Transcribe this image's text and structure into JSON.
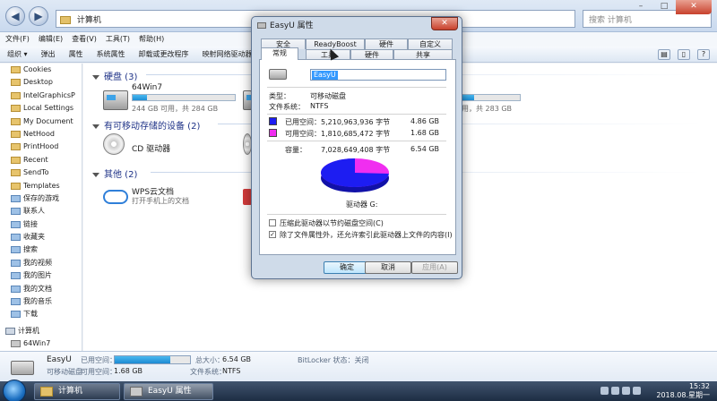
{
  "explorer": {
    "address": "计算机",
    "search_placeholder": "搜索 计算机",
    "window_buttons": {
      "min": "–",
      "max": "□",
      "close": "✕"
    },
    "menu": [
      "文件(F)",
      "编辑(E)",
      "查看(V)",
      "工具(T)",
      "帮助(H)"
    ],
    "toolbar": [
      "组织 ▾",
      "弹出",
      "属性",
      "系统属性",
      "卸载或更改程序",
      "映射网络驱动器"
    ]
  },
  "sidebar": {
    "items": [
      {
        "label": "Cookies"
      },
      {
        "label": "Desktop"
      },
      {
        "label": "IntelGraphicsP"
      },
      {
        "label": "Local Settings"
      },
      {
        "label": "My Document"
      },
      {
        "label": "NetHood"
      },
      {
        "label": "PrintHood"
      },
      {
        "label": "Recent"
      },
      {
        "label": "SendTo"
      },
      {
        "label": "Templates"
      },
      {
        "label": "保存的游戏"
      },
      {
        "label": "联系人"
      },
      {
        "label": "链接"
      },
      {
        "label": "收藏夹"
      },
      {
        "label": "搜索"
      },
      {
        "label": "我的视频"
      },
      {
        "label": "我的图片"
      },
      {
        "label": "我的文档"
      },
      {
        "label": "我的音乐"
      },
      {
        "label": "下载"
      }
    ],
    "computer": "计算机",
    "drive": "64Win7"
  },
  "content": {
    "hdd_group": "硬盘 (3)",
    "drive1_name": "64Win7",
    "drive1_sub": "244 GB 可用，共 284 GB",
    "drive1_fill": 0.14,
    "drive3_sub": "用，共 283 GB",
    "removable_group": "有可移动存储的设备 (2)",
    "cd_name": "CD 驱动器",
    "other_group": "其他 (2)",
    "wps_name": "WPS云文档",
    "wps_sub": "打开手机上的文档"
  },
  "details": {
    "name": "EasyU",
    "type": "可移动磁盘",
    "used_label": "已用空间：",
    "free_label": "可用空间：",
    "free_value": "1.68 GB",
    "total_label": "总大小：",
    "total_value": "6.54 GB",
    "fs_label": "文件系统：",
    "fs_value": "NTFS",
    "bitlocker": "BitLocker 状态：关闭",
    "used_fill": 0.74
  },
  "taskbar": {
    "task1": "计算机",
    "task2": "EasyU 属性",
    "time": "15:32",
    "date": "2018.08.星期一"
  },
  "dialog": {
    "title": "EasyU 属性",
    "close": "✕",
    "tabs_top": [
      "安全",
      "ReadyBoost",
      "硬件",
      "自定义"
    ],
    "tabs_bottom": [
      "常规",
      "工具",
      "硬件",
      "共享"
    ],
    "name_value": "EasyU",
    "type_label": "类型：",
    "type_value": "可移动磁盘",
    "fs_label": "文件系统：",
    "fs_value": "NTFS",
    "used_label": "已用空间：",
    "used_bytes": "5,210,963,936 字节",
    "used_gb": "4.86 GB",
    "free_label": "可用空间：",
    "free_bytes": "1,810,685,472 字节",
    "free_gb": "1.68 GB",
    "cap_label": "容量：",
    "cap_bytes": "7,028,649,408 字节",
    "cap_gb": "6.54 GB",
    "drive_label": "驱动器 G:",
    "compress_label": "压缩此驱动器以节约磁盘空间(C)",
    "index_label": "除了文件属性外，还允许索引此驱动器上文件的内容(I)",
    "ok": "确定",
    "cancel": "取消",
    "apply": "应用(A)",
    "used_color": "#1d1df2",
    "free_color": "#f02ef0",
    "used_fraction": 0.74
  }
}
